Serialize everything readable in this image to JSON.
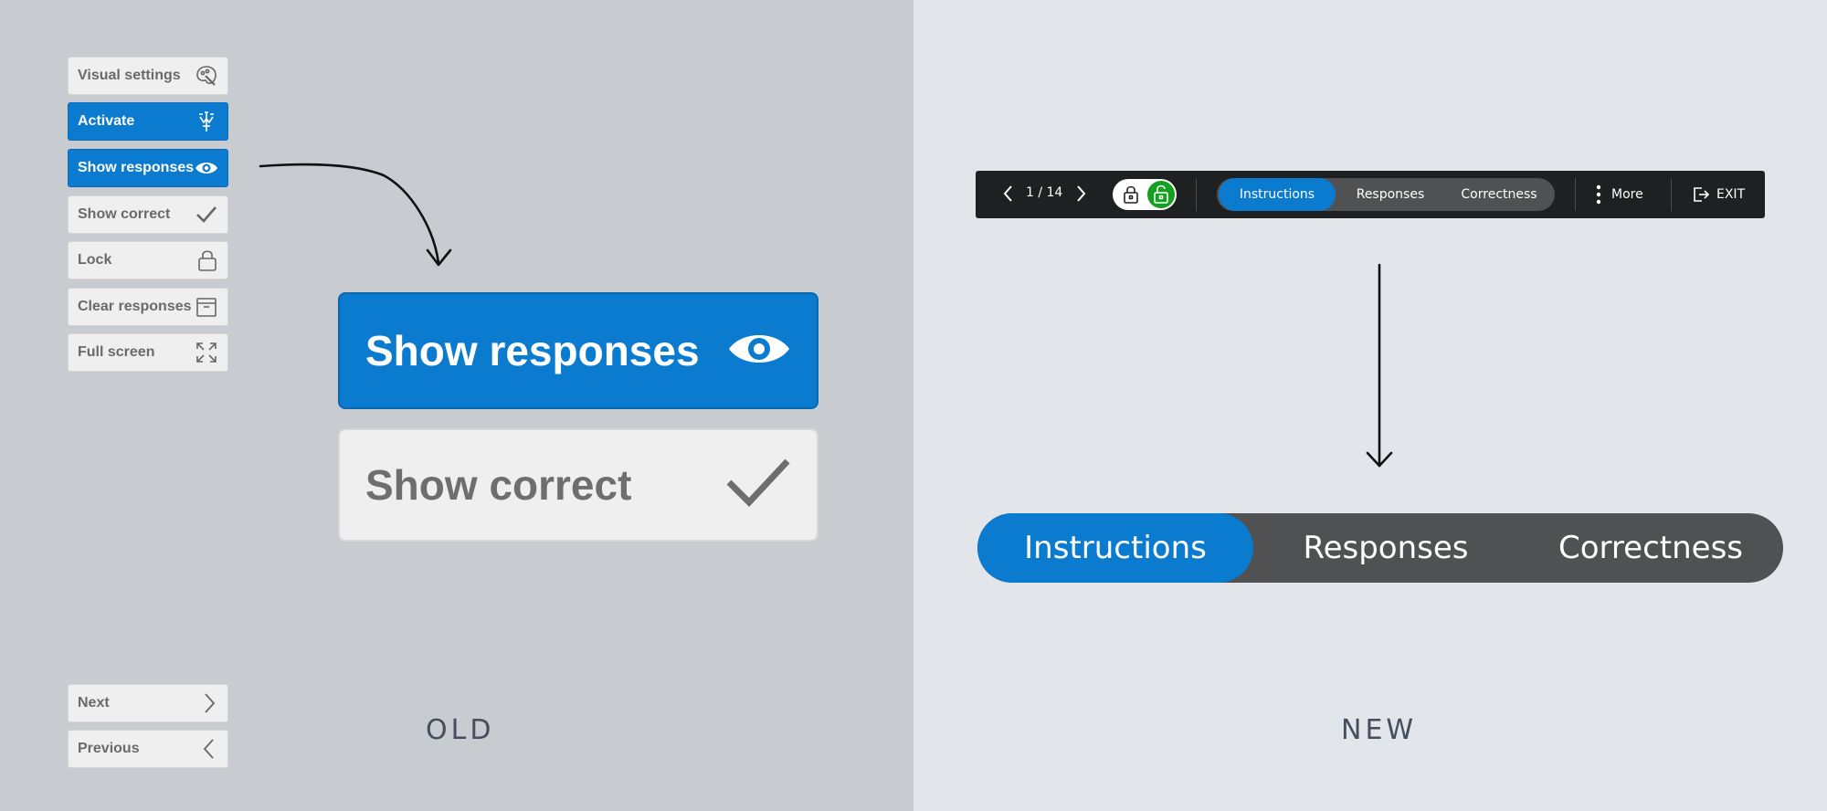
{
  "old": {
    "sidebar": [
      {
        "label": "Visual settings",
        "icon": "palette-icon",
        "active": false
      },
      {
        "label": "Activate",
        "icon": "activate-icon",
        "active": true
      },
      {
        "label": "Show responses",
        "icon": "eye-icon",
        "active": true
      },
      {
        "label": "Show correct",
        "icon": "checkmark-icon",
        "active": false
      },
      {
        "label": "Lock",
        "icon": "lock-icon",
        "active": false
      },
      {
        "label": "Clear responses",
        "icon": "archive-box-icon",
        "active": false
      },
      {
        "label": "Full screen",
        "icon": "expand-icon",
        "active": false
      }
    ],
    "nav": [
      {
        "label": "Next",
        "icon": "chevron-right-icon"
      },
      {
        "label": "Previous",
        "icon": "chevron-left-icon"
      }
    ],
    "zoom": {
      "show_responses": "Show responses",
      "show_correct": "Show correct"
    },
    "caption": "OLD"
  },
  "new": {
    "toolbar": {
      "page_indicator": "1 / 14",
      "tabs": [
        {
          "label": "Instructions",
          "selected": true
        },
        {
          "label": "Responses",
          "selected": false
        },
        {
          "label": "Correctness",
          "selected": false
        }
      ],
      "more_label": "More",
      "exit_label": "EXIT"
    },
    "segmented": {
      "tabs": [
        {
          "label": "Instructions",
          "selected": true
        },
        {
          "label": "Responses",
          "selected": false
        },
        {
          "label": "Correctness",
          "selected": false
        }
      ]
    },
    "caption": "NEW"
  },
  "colors": {
    "accent_blue": "#0b7bd0",
    "old_background": "#c8cbd0",
    "new_background": "#e2e5ea",
    "toolbar_dark": "#1f2022",
    "segment_gray": "#505153",
    "unlock_green": "#14a020"
  }
}
